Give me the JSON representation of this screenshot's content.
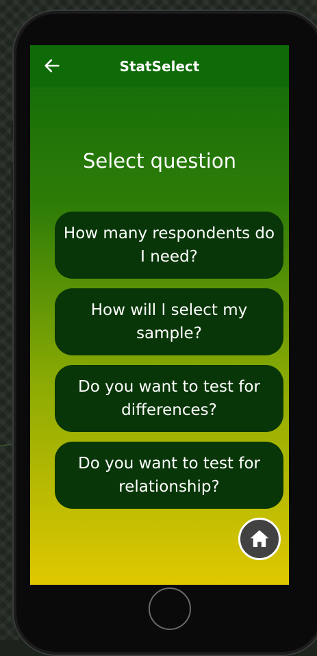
{
  "app_bar": {
    "title": "StatSelect",
    "back_icon": "arrow-left-icon"
  },
  "main": {
    "heading": "Select question",
    "options": [
      "How many respondents do I need?",
      "How will I select my sample?",
      "Do you want to test for differences?",
      "Do you want to test for relationship?"
    ],
    "home_icon": "home-icon"
  },
  "colors": {
    "app_bar": "#0f6a08",
    "gradient_top": "#0f6a09",
    "gradient_bottom": "#e0c801",
    "option_bg": "#083608",
    "home_button_bg": "#424242",
    "text": "#ffffff"
  }
}
